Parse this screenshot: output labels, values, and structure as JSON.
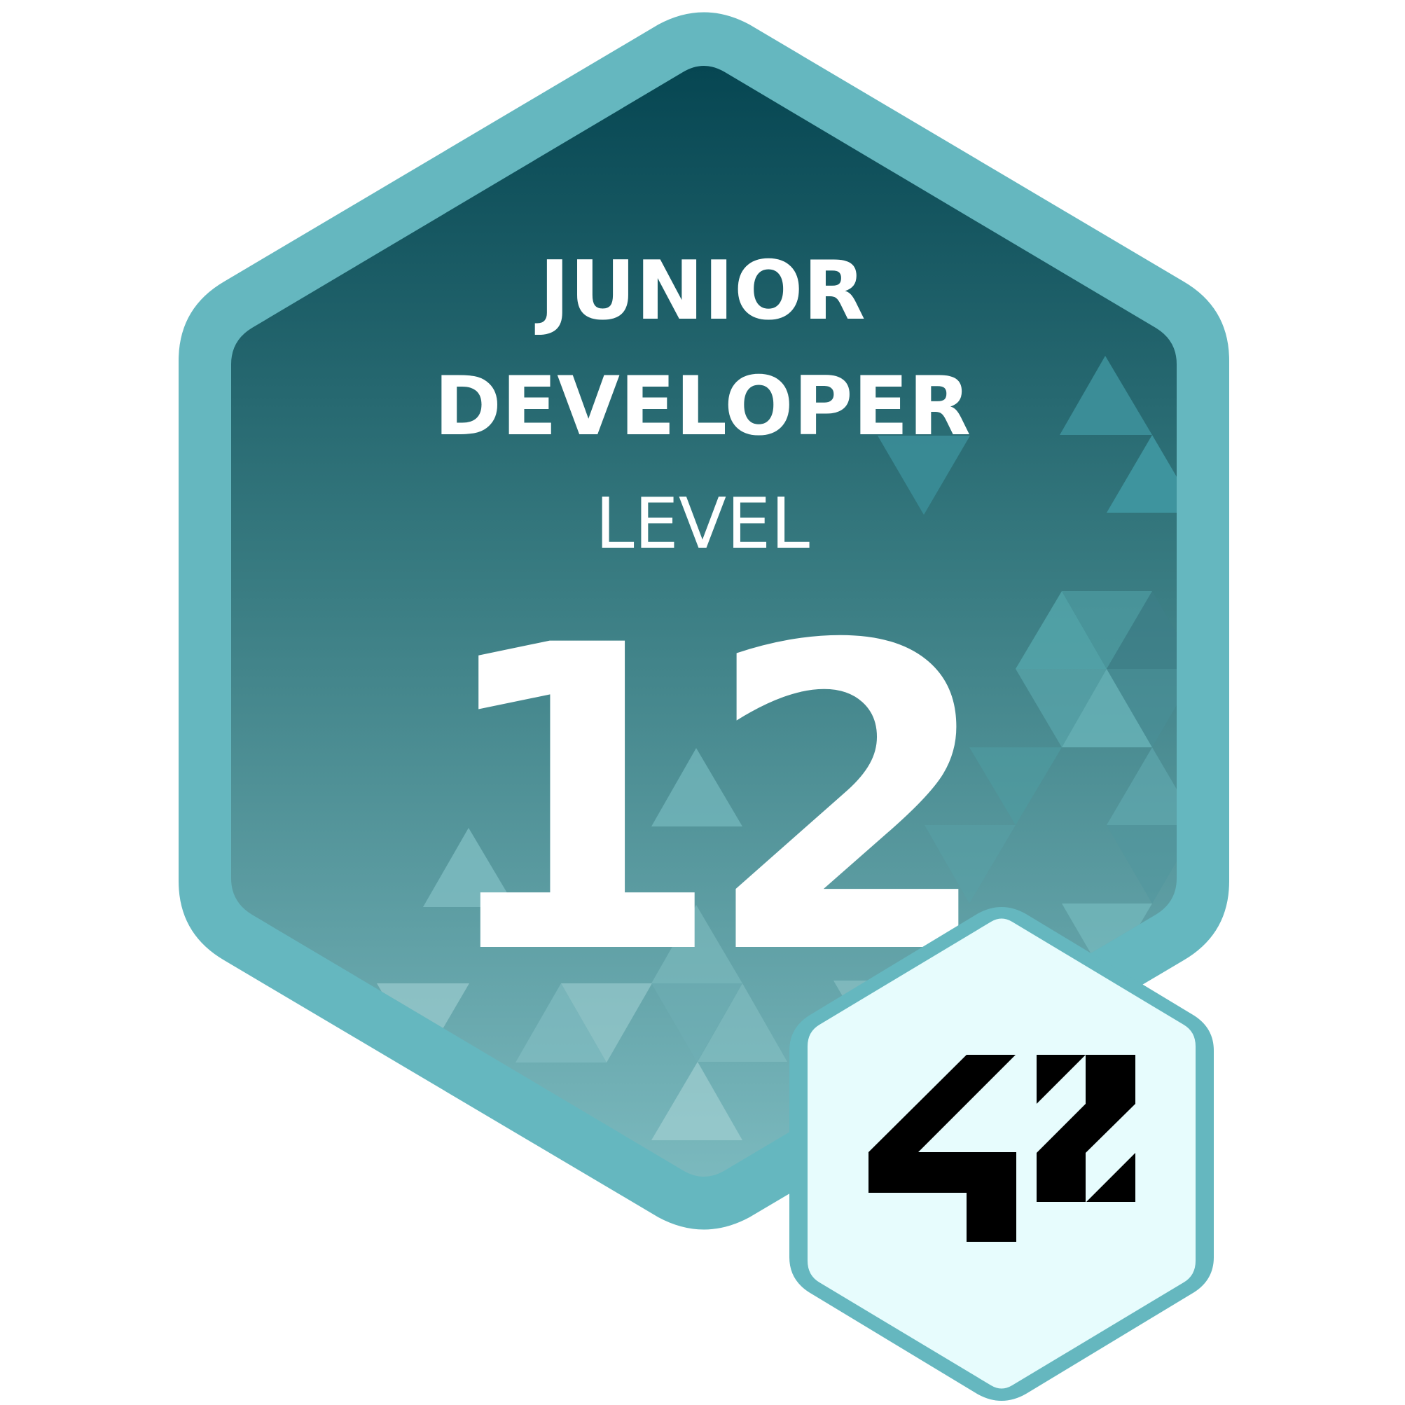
{
  "badge": {
    "title_line1": "JUNIOR",
    "title_line2": "DEVELOPER",
    "level_label": "LEVEL",
    "level_number": "12",
    "logo_text": "42"
  },
  "colors": {
    "outer_border": "#65b7bf",
    "gradient_top": "#064652",
    "gradient_bottom": "#74b5bb",
    "text": "#ffffff",
    "logo_background": "#e7fcfd",
    "logo_ink": "#000000",
    "triangle_tint": "#3c9aa5"
  },
  "icons": {
    "logo": "42-logo-icon",
    "pattern": "triangle-pattern"
  }
}
